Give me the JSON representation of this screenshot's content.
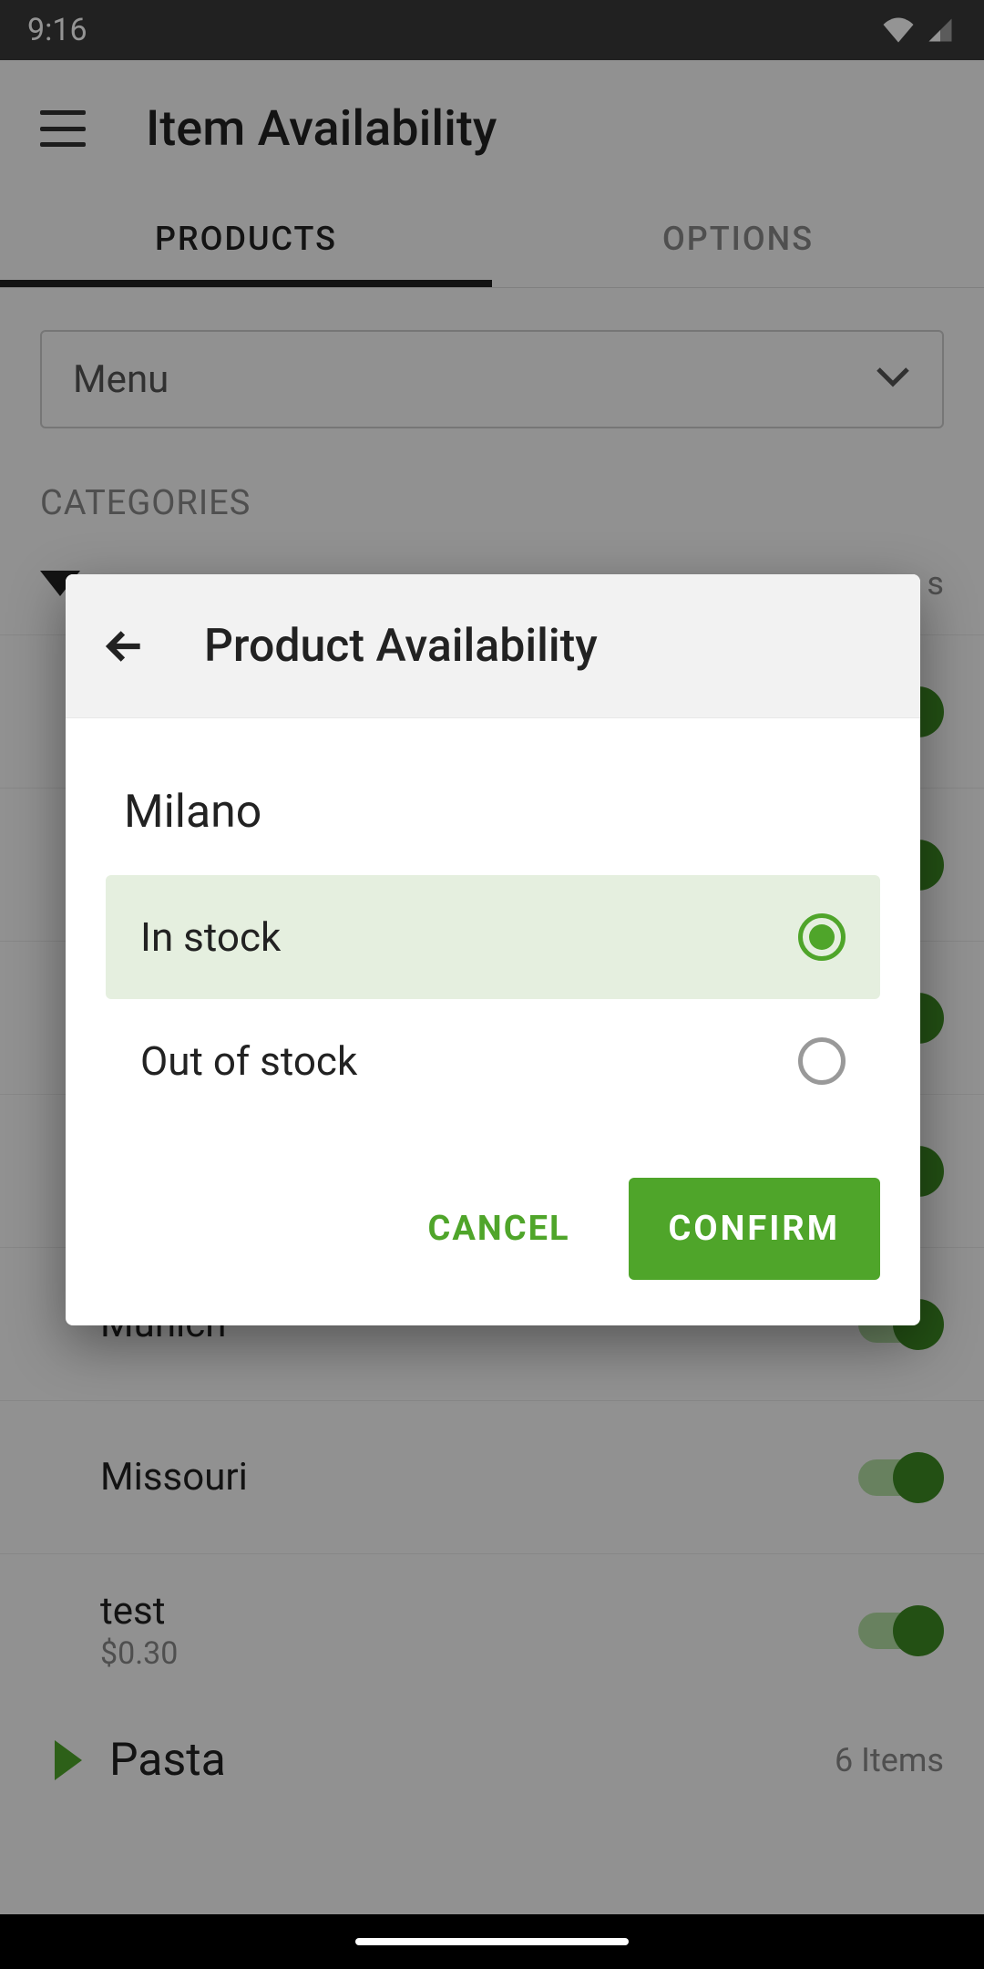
{
  "status": {
    "time": "9:16"
  },
  "header": {
    "title": "Item Availability"
  },
  "tabs": {
    "products": "PRODUCTS",
    "options": "OPTIONS"
  },
  "dropdown": {
    "label": "Menu"
  },
  "section": {
    "categories": "CATEGORIES"
  },
  "items": {
    "0": {
      "name": "Munich"
    },
    "1": {
      "name": "Missouri"
    },
    "2": {
      "name": "test",
      "price": "$0.30"
    }
  },
  "bottom": {
    "name": "Pasta",
    "count": "6 Items"
  },
  "modal": {
    "title": "Product Availability",
    "product": "Milano",
    "options": {
      "in": "In stock",
      "out": "Out of stock"
    },
    "cancel": "CANCEL",
    "confirm": "CONFIRM"
  }
}
